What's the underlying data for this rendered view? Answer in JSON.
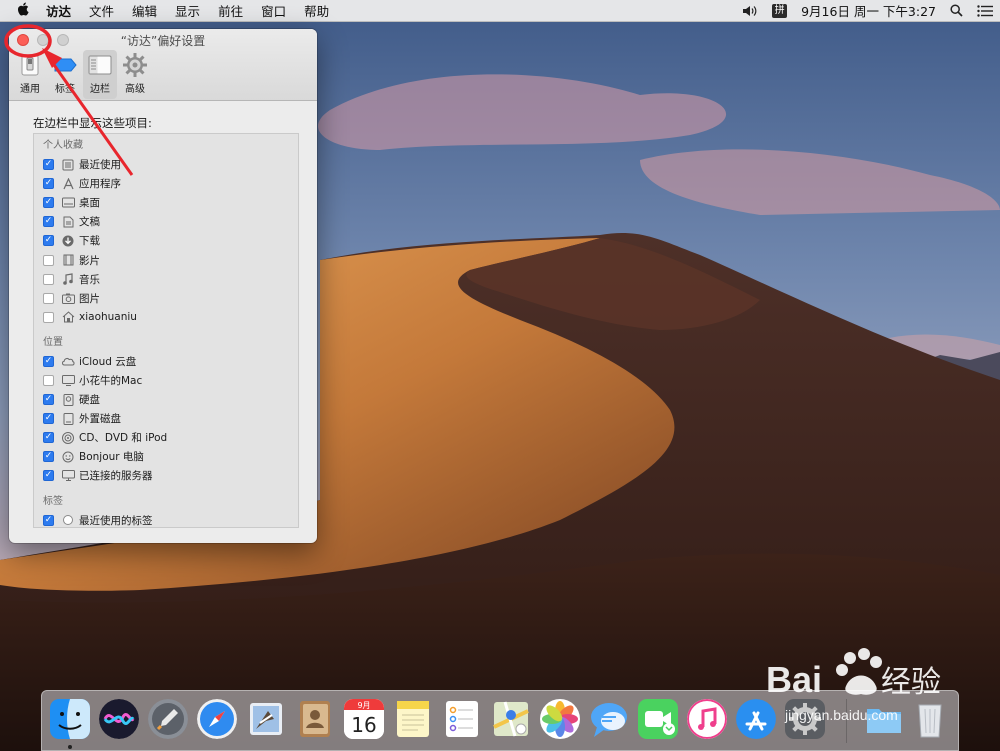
{
  "menubar": {
    "app_name": "访达",
    "items": [
      "文件",
      "编辑",
      "显示",
      "前往",
      "窗口",
      "帮助"
    ],
    "input_method": "拼",
    "clock": "9月16日 周一 下午3:27"
  },
  "window": {
    "title": "“访达”偏好设置",
    "tabs": [
      {
        "label": "通用",
        "icon": "general-switch-icon",
        "active": false
      },
      {
        "label": "标签",
        "icon": "tags-icon",
        "active": false
      },
      {
        "label": "边栏",
        "icon": "sidebar-icon",
        "active": true
      },
      {
        "label": "高级",
        "icon": "gear-icon",
        "active": false
      }
    ],
    "heading": "在边栏中显示这些项目:",
    "sections": [
      {
        "title": "个人收藏",
        "items": [
          {
            "label": "最近使用",
            "checked": true,
            "icon": "recents-icon"
          },
          {
            "label": "应用程序",
            "checked": true,
            "icon": "applications-icon"
          },
          {
            "label": "桌面",
            "checked": true,
            "icon": "desktop-icon"
          },
          {
            "label": "文稿",
            "checked": true,
            "icon": "documents-icon"
          },
          {
            "label": "下载",
            "checked": true,
            "icon": "downloads-icon"
          },
          {
            "label": "影片",
            "checked": false,
            "icon": "movies-icon"
          },
          {
            "label": "音乐",
            "checked": false,
            "icon": "music-icon"
          },
          {
            "label": "图片",
            "checked": false,
            "icon": "pictures-icon"
          },
          {
            "label": "xiaohuaniu",
            "checked": false,
            "icon": "home-icon"
          }
        ]
      },
      {
        "title": "位置",
        "items": [
          {
            "label": "iCloud 云盘",
            "checked": true,
            "icon": "icloud-icon"
          },
          {
            "label": "小花牛的Mac",
            "checked": false,
            "icon": "computer-icon"
          },
          {
            "label": "硬盘",
            "checked": true,
            "icon": "hard-disk-icon"
          },
          {
            "label": "外置磁盘",
            "checked": true,
            "icon": "external-disk-icon"
          },
          {
            "label": "CD、DVD 和 iPod",
            "checked": true,
            "icon": "cd-icon"
          },
          {
            "label": "Bonjour 电脑",
            "checked": true,
            "icon": "bonjour-icon"
          },
          {
            "label": "已连接的服务器",
            "checked": true,
            "icon": "server-icon"
          }
        ]
      },
      {
        "title": "标签",
        "items": [
          {
            "label": "最近使用的标签",
            "checked": true,
            "icon": "tag-circle-icon"
          }
        ]
      }
    ]
  },
  "dock": {
    "calendar_month": "9月",
    "calendar_day": "16",
    "apps": [
      "finder-icon",
      "siri-icon",
      "launchpad-icon",
      "safari-icon",
      "mail-icon",
      "contacts-icon",
      "calendar-icon",
      "notes-icon",
      "reminders-icon",
      "maps-icon",
      "photos-icon",
      "messages-icon",
      "facetime-icon",
      "itunes-icon",
      "app-store-icon",
      "system-preferences-icon",
      "downloads-folder-icon",
      "trash-icon"
    ]
  },
  "watermark": {
    "brand": "Bai",
    "brand_cn": "经验",
    "url": "jingyan.baidu.com"
  },
  "colors": {
    "accent": "#2d7bef",
    "close_button": "#fc5f57",
    "annotation": "#e8262d"
  }
}
